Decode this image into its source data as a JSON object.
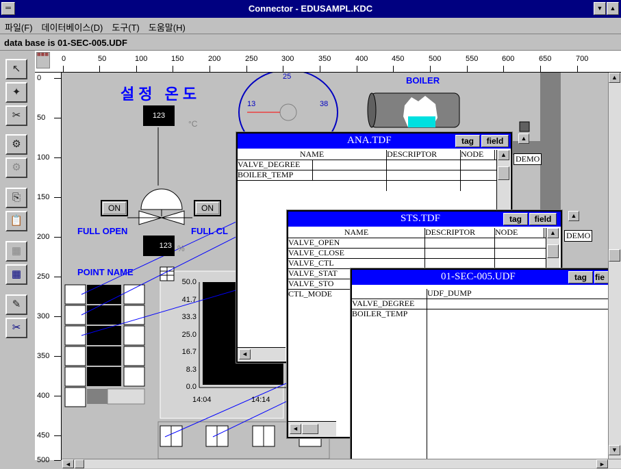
{
  "window": {
    "title": "Connector - EDUSAMPL.KDC"
  },
  "menu": [
    {
      "label": "파일(F)"
    },
    {
      "label": "데이터베이스(D)"
    },
    {
      "label": "도구(T)"
    },
    {
      "label": "도움말(H)"
    }
  ],
  "status": "data base is 01-SEC-005.UDF",
  "ruler_h": [
    "0",
    "50",
    "100",
    "150",
    "200",
    "250",
    "300",
    "350",
    "400",
    "450",
    "500",
    "550",
    "600",
    "650",
    "700"
  ],
  "ruler_v": [
    "0",
    "50",
    "100",
    "150",
    "200",
    "250",
    "300",
    "350",
    "400",
    "450",
    "500"
  ],
  "canvas": {
    "korean_title": "설정 온도",
    "setpoint_value": "123",
    "setpoint_unit": "°C",
    "gauge_top": "25",
    "gauge_left": "13",
    "gauge_right": "38",
    "boiler_label": "BOILER",
    "on_left": "ON",
    "on_right": "ON",
    "full_open": "FULL OPEN",
    "full_close": "FULL CL",
    "valve_value": "123",
    "valve_unit": "%",
    "point_name": "POINT NAME",
    "chart_y": [
      "50.0",
      "41.7",
      "33.3",
      "25.0",
      "16.7",
      "8.3",
      "0.0"
    ],
    "chart_x": [
      "14:04",
      "14:14"
    ]
  },
  "ana_window": {
    "title": "ANA.TDF",
    "tag_btn": "tag",
    "field_btn": "field",
    "columns": [
      "NAME",
      "DESCRIPTOR",
      "NODE"
    ],
    "rows": [
      "VALVE_DEGREE",
      "BOILER_TEMP"
    ],
    "demo": "DEMO"
  },
  "sts_window": {
    "title": "STS.TDF",
    "tag_btn": "tag",
    "field_btn": "field",
    "columns": [
      "NAME",
      "DESCRIPTOR",
      "NODE"
    ],
    "rows": [
      "VALVE_OPEN",
      "VALVE_CLOSE",
      "VALVE_CTL",
      "VALVE_STAT",
      "VALVE_STO",
      "CTL_MODE"
    ],
    "demo": "DEMO"
  },
  "udf_window": {
    "title": "01-SEC-005.UDF",
    "tag_btn": "tag",
    "field_btn": "fie",
    "columns": [
      "UDF_DUMP"
    ],
    "rows": [
      "VALVE_DEGREE",
      "BOILER_TEMP"
    ]
  }
}
